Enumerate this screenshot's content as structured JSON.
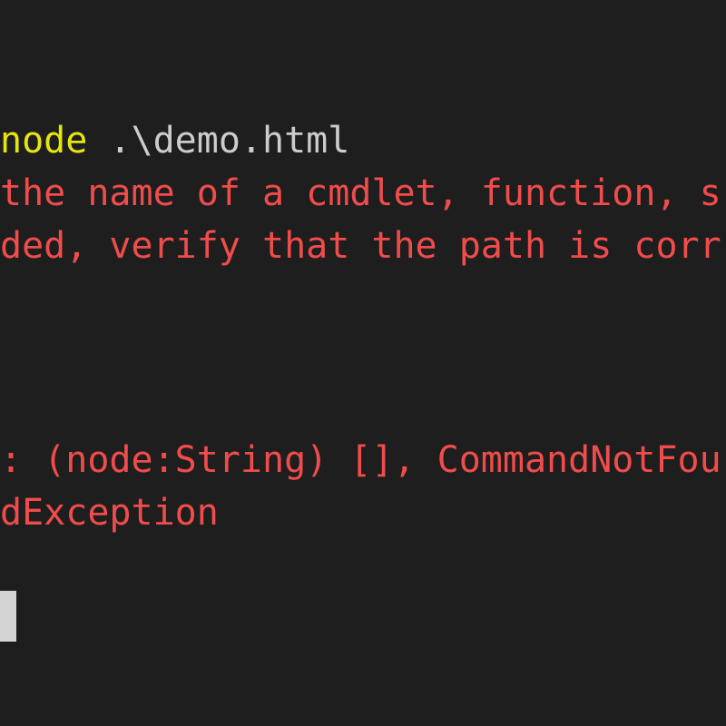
{
  "terminal": {
    "command": {
      "executable": "node",
      "argument": " .\\demo.html"
    },
    "error_lines": [
      "the name of a cmdlet, function, s",
      "ded, verify that the path is corr",
      ": (node:String) [], CommandNotFou",
      "dException"
    ],
    "colors": {
      "background": "#1e1e1e",
      "command": "#e5e510",
      "argument": "#cccccc",
      "error": "#f14c4c",
      "cursor": "#d4d4d4"
    }
  }
}
